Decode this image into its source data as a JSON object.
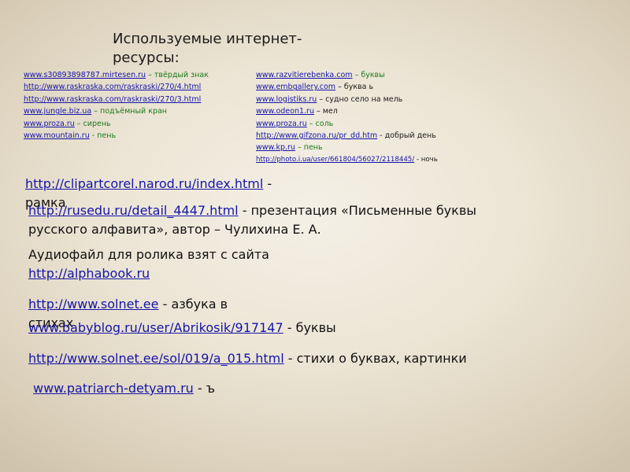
{
  "title": "Используемые интернет-ресурсы:",
  "left_column": [
    {
      "url": "www.s30893898787.mirtesen.ru",
      "note": " – твёрдый знак",
      "style": "green"
    },
    {
      "url": "http://www.raskraska.com/raskraski/270/4.html",
      "note": "",
      "style": "green"
    },
    {
      "url": "http://www.raskraska.com/raskraski/270/3.html",
      "note": "",
      "style": "green"
    },
    {
      "url": "www.jungle.biz.ua",
      "note": " – подъёмный кран",
      "style": "green"
    },
    {
      "url": "www.proza.ru",
      "note": " – сирень",
      "style": "green"
    },
    {
      "url": "www.mountain.ru",
      "note": "  - пень",
      "style": "green"
    }
  ],
  "right_column": [
    {
      "url": "www.razvitierebenka.com",
      "note": "  – буквы",
      "style": "green"
    },
    {
      "url": "www.embgallery.com",
      "note": "   – буква ь",
      "style": "dark"
    },
    {
      "url": "www.logistiks.ru",
      "note": "  – судно село на мель",
      "style": "dark"
    },
    {
      "url": "www.odeon1.ru",
      "note": " – мел",
      "style": "dark"
    },
    {
      "url": "www.proza.ru",
      "note": "  – соль",
      "style": "green"
    },
    {
      "url": "http://www.gifzona.ru/pr_dd.htm",
      "note": " - добрый день",
      "style": "dark"
    },
    {
      "url": "www.kp.ru",
      "note": "  – пень",
      "style": "green"
    },
    {
      "url": "http://photo.i.ua/user/661804/56027/2118445/",
      "note": " - ночь",
      "style": "dark"
    }
  ],
  "big_links": {
    "b1": {
      "url": "http://clipartcorel.narod.ru/index.html",
      "text": " - рамка"
    },
    "b2": {
      "url": "http://rusedu.ru/detail_4447.html",
      "text": " - презентация «Письменные буквы русского алфавита», автор – Чулихина Е. А."
    },
    "b3": {
      "prefix": "Аудиофайл для ролика взят с сайта ",
      "url": "http://alphabook.ru"
    },
    "b4": {
      "url": "http://www.solnet.ee",
      "text": "  - азбука в стихах"
    },
    "b5": {
      "url": "www.babyblog.ru/user/Abrikosik/917147",
      "text": " - буквы"
    },
    "b6": {
      "url": "http://www.solnet.ee/sol/019/a_015.html",
      "text": " - стихи о буквах, картинки"
    },
    "b7": {
      "url": "www.patriarch-detyam.ru",
      "text": " - ъ"
    }
  }
}
